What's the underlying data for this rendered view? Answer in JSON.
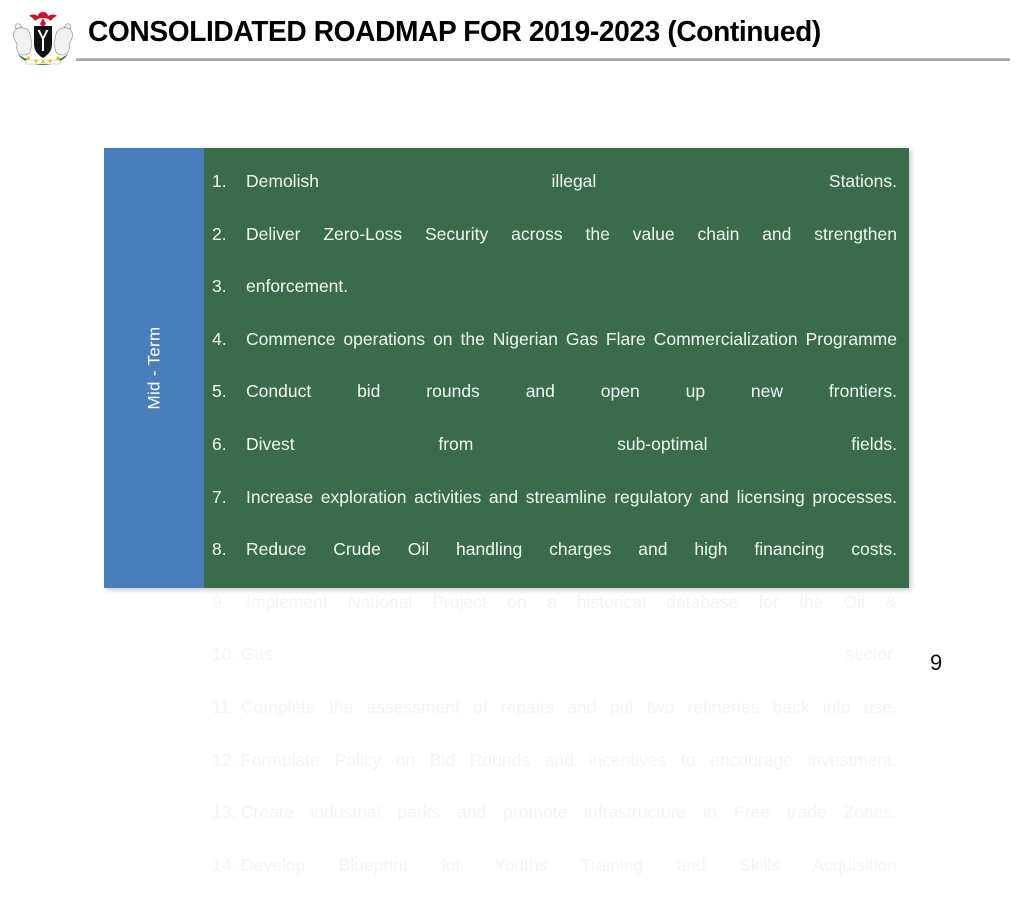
{
  "header": {
    "title": "CONSOLIDATED ROADMAP FOR 2019-2023 (Continued)",
    "logo_name": "nigeria-coat-of-arms",
    "rule_color": "#a6a6a6"
  },
  "content": {
    "term_label": "Mid - Term",
    "term_cell_color": "#4a7ebb",
    "items_cell_color": "#3a6b4b",
    "items": [
      {
        "number": "1.",
        "text": "Demolish illegal Stations."
      },
      {
        "number": "2.",
        "text": "Deliver Zero-Loss Security across the value chain and strengthen"
      },
      {
        "number": "3.",
        "text": "enforcement."
      },
      {
        "number": "4.",
        "text": "Commence operations on the Nigerian Gas Flare  Commercialization Programme"
      },
      {
        "number": "5.",
        "text": "Conduct bid rounds and open up new frontiers."
      },
      {
        "number": "6.",
        "text": "Divest from sub-optimal fields."
      },
      {
        "number": "7.",
        "text": "Increase exploration activities and streamline regulatory and licensing processes."
      },
      {
        "number": "8.",
        "text": "Reduce Crude Oil handling charges and high financing costs."
      },
      {
        "number": "9.",
        "text": "Implement National Project on a historical database for the Oil &"
      },
      {
        "number": "10.",
        "text": "Gas sector."
      },
      {
        "number": "11.",
        "text": "Complete the assessment of repairs and put two refineries back into use."
      },
      {
        "number": "12.",
        "text": "Formulate Policy on Bid Rounds and incentives to encourage investment."
      },
      {
        "number": "13.",
        "text": "Create industrial parks and promote infrastructure in Free trade  Zones."
      },
      {
        "number": "14.",
        "text": "Develop Blueprint for Youths Training and Skills Acquisition"
      }
    ]
  },
  "footer": {
    "page_number": "9"
  }
}
